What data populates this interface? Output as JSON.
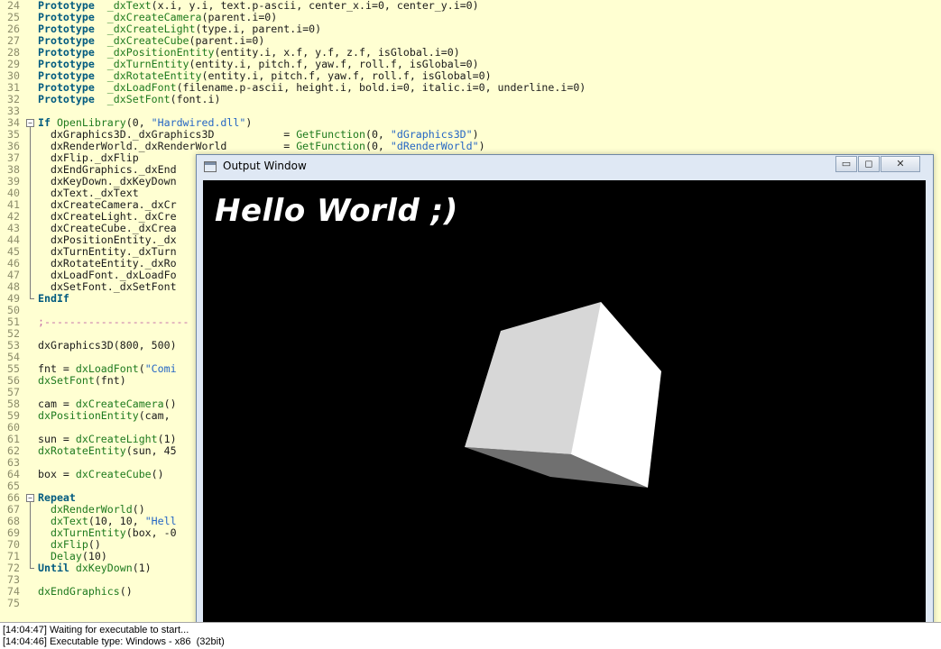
{
  "editor": {
    "lines": [
      {
        "n": "24",
        "parts": [
          [
            "kw",
            "Prototype"
          ],
          [
            "",
            "  "
          ],
          [
            "fn",
            "_dxText"
          ],
          [
            "",
            "(x.i, y.i, text.p-ascii, center_x.i=0, center_y.i=0)"
          ]
        ]
      },
      {
        "n": "25",
        "parts": [
          [
            "kw",
            "Prototype"
          ],
          [
            "",
            "  "
          ],
          [
            "fn",
            "_dxCreateCamera"
          ],
          [
            "",
            "(parent.i=0)"
          ]
        ]
      },
      {
        "n": "26",
        "parts": [
          [
            "kw",
            "Prototype"
          ],
          [
            "",
            "  "
          ],
          [
            "fn",
            "_dxCreateLight"
          ],
          [
            "",
            "(type.i, parent.i=0)"
          ]
        ]
      },
      {
        "n": "27",
        "parts": [
          [
            "kw",
            "Prototype"
          ],
          [
            "",
            "  "
          ],
          [
            "fn",
            "_dxCreateCube"
          ],
          [
            "",
            "(parent.i=0)"
          ]
        ]
      },
      {
        "n": "28",
        "parts": [
          [
            "kw",
            "Prototype"
          ],
          [
            "",
            "  "
          ],
          [
            "fn",
            "_dxPositionEntity"
          ],
          [
            "",
            "(entity.i, x.f, y.f, z.f, isGlobal.i=0)"
          ]
        ]
      },
      {
        "n": "29",
        "parts": [
          [
            "kw",
            "Prototype"
          ],
          [
            "",
            "  "
          ],
          [
            "fn",
            "_dxTurnEntity"
          ],
          [
            "",
            "(entity.i, pitch.f, yaw.f, roll.f, isGlobal=0)"
          ]
        ]
      },
      {
        "n": "30",
        "parts": [
          [
            "kw",
            "Prototype"
          ],
          [
            "",
            "  "
          ],
          [
            "fn",
            "_dxRotateEntity"
          ],
          [
            "",
            "(entity.i, pitch.f, yaw.f, roll.f, isGlobal=0)"
          ]
        ]
      },
      {
        "n": "31",
        "parts": [
          [
            "kw",
            "Prototype"
          ],
          [
            "",
            "  "
          ],
          [
            "fn",
            "_dxLoadFont"
          ],
          [
            "",
            "(filename.p-ascii, height.i, bold.i=0, italic.i=0, underline.i=0)"
          ]
        ]
      },
      {
        "n": "32",
        "parts": [
          [
            "kw",
            "Prototype"
          ],
          [
            "",
            "  "
          ],
          [
            "fn",
            "_dxSetFont"
          ],
          [
            "",
            "(font.i)"
          ]
        ]
      },
      {
        "n": "33",
        "parts": []
      },
      {
        "n": "34",
        "fold": "open",
        "parts": [
          [
            "kw",
            "If"
          ],
          [
            "",
            " "
          ],
          [
            "fn",
            "OpenLibrary"
          ],
          [
            "",
            "(0, "
          ],
          [
            "str",
            "\"Hardwired.dll\""
          ],
          [
            "",
            ")"
          ]
        ]
      },
      {
        "n": "35",
        "parts": [
          [
            "",
            "  dxGraphics3D._dxGraphics3D           = "
          ],
          [
            "fn",
            "GetFunction"
          ],
          [
            "",
            "(0, "
          ],
          [
            "str",
            "\"dGraphics3D\""
          ],
          [
            "",
            ")"
          ]
        ]
      },
      {
        "n": "36",
        "parts": [
          [
            "",
            "  dxRenderWorld._dxRenderWorld         = "
          ],
          [
            "fn",
            "GetFunction"
          ],
          [
            "",
            "(0, "
          ],
          [
            "str",
            "\"dRenderWorld\""
          ],
          [
            "",
            ")"
          ]
        ]
      },
      {
        "n": "37",
        "parts": [
          [
            "",
            "  dxFlip._dxFlip"
          ]
        ]
      },
      {
        "n": "38",
        "parts": [
          [
            "",
            "  dxEndGraphics._dxEnd"
          ]
        ]
      },
      {
        "n": "39",
        "parts": [
          [
            "",
            "  dxKeyDown._dxKeyDown"
          ]
        ]
      },
      {
        "n": "40",
        "parts": [
          [
            "",
            "  dxText._dxText"
          ]
        ]
      },
      {
        "n": "41",
        "parts": [
          [
            "",
            "  dxCreateCamera._dxCr"
          ]
        ]
      },
      {
        "n": "42",
        "parts": [
          [
            "",
            "  dxCreateLight._dxCre"
          ]
        ]
      },
      {
        "n": "43",
        "parts": [
          [
            "",
            "  dxCreateCube._dxCrea"
          ]
        ]
      },
      {
        "n": "44",
        "parts": [
          [
            "",
            "  dxPositionEntity._dx"
          ]
        ]
      },
      {
        "n": "45",
        "parts": [
          [
            "",
            "  dxTurnEntity._dxTurn"
          ]
        ]
      },
      {
        "n": "46",
        "parts": [
          [
            "",
            "  dxRotateEntity._dxRo"
          ]
        ]
      },
      {
        "n": "47",
        "parts": [
          [
            "",
            "  dxLoadFont._dxLoadFo"
          ]
        ]
      },
      {
        "n": "48",
        "parts": [
          [
            "",
            "  dxSetFont._dxSetFont"
          ]
        ]
      },
      {
        "n": "49",
        "fold": "end",
        "parts": [
          [
            "kw",
            "EndIf"
          ]
        ]
      },
      {
        "n": "50",
        "parts": []
      },
      {
        "n": "51",
        "parts": [
          [
            "cm",
            ";-----------------------"
          ]
        ]
      },
      {
        "n": "52",
        "parts": []
      },
      {
        "n": "53",
        "parts": [
          [
            "",
            "dxGraphics3D(800, 500)"
          ]
        ]
      },
      {
        "n": "54",
        "parts": []
      },
      {
        "n": "55",
        "parts": [
          [
            "",
            "fnt = "
          ],
          [
            "fn",
            "dxLoadFont"
          ],
          [
            "",
            "("
          ],
          [
            "str",
            "\"Comi"
          ]
        ]
      },
      {
        "n": "56",
        "parts": [
          [
            "fn",
            "dxSetFont"
          ],
          [
            "",
            "(fnt)"
          ]
        ]
      },
      {
        "n": "57",
        "parts": []
      },
      {
        "n": "58",
        "parts": [
          [
            "",
            "cam = "
          ],
          [
            "fn",
            "dxCreateCamera"
          ],
          [
            "",
            "()"
          ]
        ]
      },
      {
        "n": "59",
        "parts": [
          [
            "fn",
            "dxPositionEntity"
          ],
          [
            "",
            "(cam,"
          ]
        ]
      },
      {
        "n": "60",
        "parts": []
      },
      {
        "n": "61",
        "parts": [
          [
            "",
            "sun = "
          ],
          [
            "fn",
            "dxCreateLight"
          ],
          [
            "",
            "(1)"
          ]
        ]
      },
      {
        "n": "62",
        "parts": [
          [
            "fn",
            "dxRotateEntity"
          ],
          [
            "",
            "(sun, 45"
          ]
        ]
      },
      {
        "n": "63",
        "parts": []
      },
      {
        "n": "64",
        "parts": [
          [
            "",
            "box = "
          ],
          [
            "fn",
            "dxCreateCube"
          ],
          [
            "",
            "()"
          ]
        ]
      },
      {
        "n": "65",
        "parts": []
      },
      {
        "n": "66",
        "fold": "open",
        "parts": [
          [
            "kw",
            "Repeat"
          ]
        ]
      },
      {
        "n": "67",
        "parts": [
          [
            "",
            "  "
          ],
          [
            "fn",
            "dxRenderWorld"
          ],
          [
            "",
            "()"
          ]
        ]
      },
      {
        "n": "68",
        "parts": [
          [
            "",
            "  "
          ],
          [
            "fn",
            "dxText"
          ],
          [
            "",
            "(10, 10, "
          ],
          [
            "str",
            "\"Hell"
          ]
        ]
      },
      {
        "n": "69",
        "parts": [
          [
            "",
            "  "
          ],
          [
            "fn",
            "dxTurnEntity"
          ],
          [
            "",
            "(box, -0"
          ]
        ]
      },
      {
        "n": "70",
        "parts": [
          [
            "",
            "  "
          ],
          [
            "fn",
            "dxFlip"
          ],
          [
            "",
            "()"
          ]
        ]
      },
      {
        "n": "71",
        "parts": [
          [
            "",
            "  "
          ],
          [
            "fn",
            "Delay"
          ],
          [
            "",
            "(10)"
          ]
        ]
      },
      {
        "n": "72",
        "fold": "end",
        "parts": [
          [
            "kw",
            "Until"
          ],
          [
            "",
            " "
          ],
          [
            "fn",
            "dxKeyDown"
          ],
          [
            "",
            "(1)"
          ]
        ]
      },
      {
        "n": "73",
        "parts": []
      },
      {
        "n": "74",
        "parts": [
          [
            "fn",
            "dxEndGraphics"
          ],
          [
            "",
            "()"
          ]
        ]
      },
      {
        "n": "75",
        "parts": []
      }
    ]
  },
  "output_window": {
    "title": "Output Window",
    "icon": "window-app-icon",
    "buttons": {
      "minimize": "▭",
      "maximize": "◻",
      "close": "✕"
    },
    "render_text": "Hello World ;)"
  },
  "status_log": {
    "lines": [
      "[14:04:47] Waiting for executable to start...",
      "[14:04:46] Executable type: Windows - x86  (32bit)"
    ]
  },
  "colors": {
    "editor_bg": "#ffffd2",
    "keyword": "#005a7f",
    "function": "#1e7a1e",
    "string": "#2566c4",
    "comment": "#c56aa8",
    "viewport_bg": "#000000",
    "cube_face_top": "#d7d7d7",
    "cube_face_right": "#ffffff",
    "cube_face_bottom": "#707070"
  }
}
